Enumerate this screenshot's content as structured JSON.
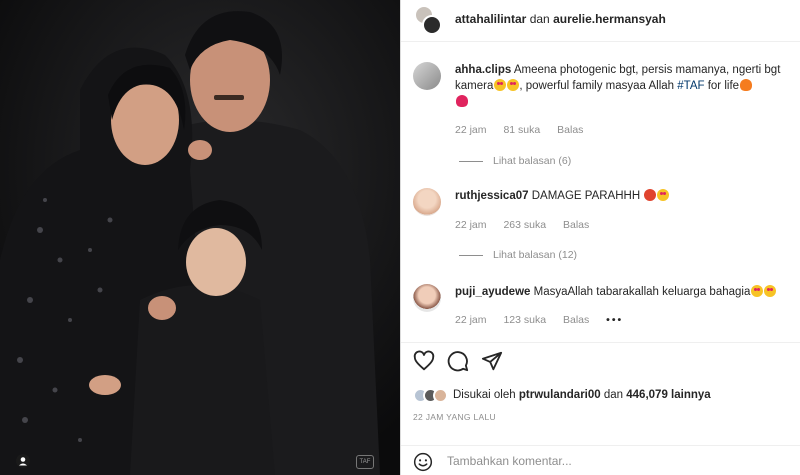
{
  "post": {
    "authors": [
      "attahalilintar",
      "aurelie.hermansyah"
    ],
    "author_joiner": "dan",
    "photo_watermark": "TAF"
  },
  "comments": [
    {
      "user": "ahha.clips",
      "text_before_tag": "Ameena photogenic bgt, persis mamanya, ngerti bgt kamera",
      "text_mid": ", powerful family masyaa Allah",
      "tag": "#TAF",
      "text_after_tag": "for life",
      "time": "22 jam",
      "likes": "81 suka",
      "reply_label": "Balas",
      "view_replies": "Lihat balasan (6)"
    },
    {
      "user": "ruthjessica07",
      "text": "DAMAGE PARAHHH",
      "time": "22 jam",
      "likes": "263 suka",
      "reply_label": "Balas",
      "view_replies": "Lihat balasan (12)"
    },
    {
      "user": "puji_ayudewe",
      "text": "MasyaAllah tabarakallah keluarga bahagia",
      "time": "22 jam",
      "likes": "123 suka",
      "reply_label": "Balas",
      "more": "•••"
    }
  ],
  "actions": {
    "icons": [
      "heart-icon",
      "comment-icon",
      "share-icon"
    ]
  },
  "likes": {
    "prefix": "Disukai oleh",
    "user": "ptrwulandari00",
    "joiner": "dan",
    "count": "446,079 lainnya"
  },
  "timestamp": "22 JAM YANG LALU",
  "composer": {
    "placeholder": "Tambahkan komentar..."
  },
  "colors": {
    "link": "#00376b",
    "muted": "#8e8e8e",
    "text": "#262626",
    "photo_bg": "#0e0e0f"
  }
}
